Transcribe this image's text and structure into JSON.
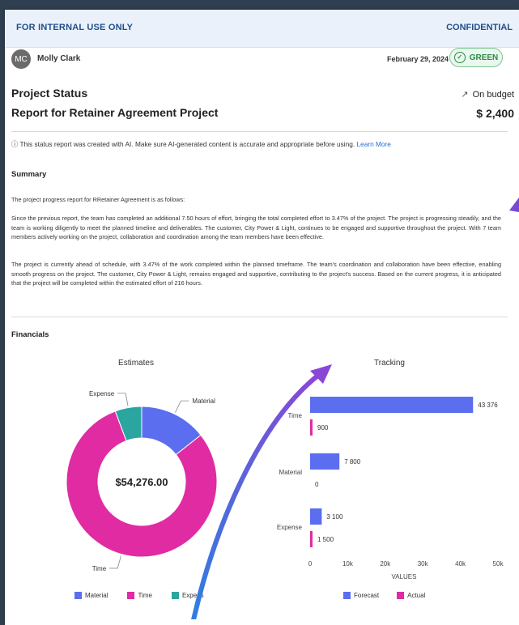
{
  "header": {
    "left": "FOR INTERNAL USE ONLY",
    "right": "CONFIDENTIAL"
  },
  "author": {
    "initials": "MC",
    "name": "Molly Clark"
  },
  "date": "February 29, 2024",
  "status": "GREEN",
  "project": {
    "title_line1": "Project Status",
    "title_line2": "Report for Retainer Agreement Project",
    "budget_label": "On budget",
    "amount": "$ 2,400"
  },
  "ai_note": {
    "text": "This status report was created with AI. Make sure AI-generated content is accurate and appropriate before using.",
    "link": "Learn More"
  },
  "summary": {
    "heading": "Summary",
    "p0": "The project progress report for RRetainer Agreement is as follows:",
    "p1": "Since the previous report, the team has completed an additional 7.50 hours of effort, bringing the total completed effort to 3.47% of the project. The project is progressing steadily, and the team is working diligently to meet the planned timeline and deliverables. The customer, City Power & Light, continues to be engaged and supportive throughout the project. With 7 team members actively working on the project, collaboration and coordination among the team members have been effective.",
    "p2": "The project is currently ahead of schedule, with 3.47% of the work completed within the planned timeframe. The team's coordination and collaboration have been effective, enabling smooth progress on the project. The customer, City Power & Light, remains engaged and supportive, contributing to the project's success. Based on the current progress, it is anticipated that the project will be completed within the estimated effort of 216 hours."
  },
  "financials": {
    "heading": "Financials"
  },
  "colors": {
    "material": "#5b6ef0",
    "time": "#e02ba3",
    "expense": "#2aa59f",
    "forecast": "#5b6ef0",
    "actual": "#e02ba3"
  },
  "chart_data": [
    {
      "type": "pie",
      "title": "Estimates",
      "center_label": "$54,276.00",
      "labels": [
        "Material",
        "Time",
        "Expense"
      ],
      "values": [
        7800,
        43376,
        3100
      ],
      "legend": [
        "Material",
        "Time",
        "Expens"
      ]
    },
    {
      "type": "bar",
      "title": "Tracking",
      "categories": [
        "Time",
        "Material",
        "Expense"
      ],
      "series": [
        {
          "name": "Forecast",
          "values": [
            43376,
            7800,
            3100
          ]
        },
        {
          "name": "Actual",
          "values": [
            900,
            0,
            1500
          ]
        }
      ],
      "value_labels": {
        "Forecast": [
          "43 376",
          "7 800",
          "3 100"
        ],
        "Actual": [
          "900",
          "0",
          "1 500"
        ]
      },
      "category_labels": [
        "Time",
        "Material",
        "Expense"
      ],
      "xlabel": "VALUES",
      "xlim": [
        0,
        50000
      ],
      "xticks": [
        "0",
        "10k",
        "20k",
        "30k",
        "40k",
        "50k"
      ],
      "legend": [
        "Forecast",
        "Actual"
      ]
    }
  ]
}
